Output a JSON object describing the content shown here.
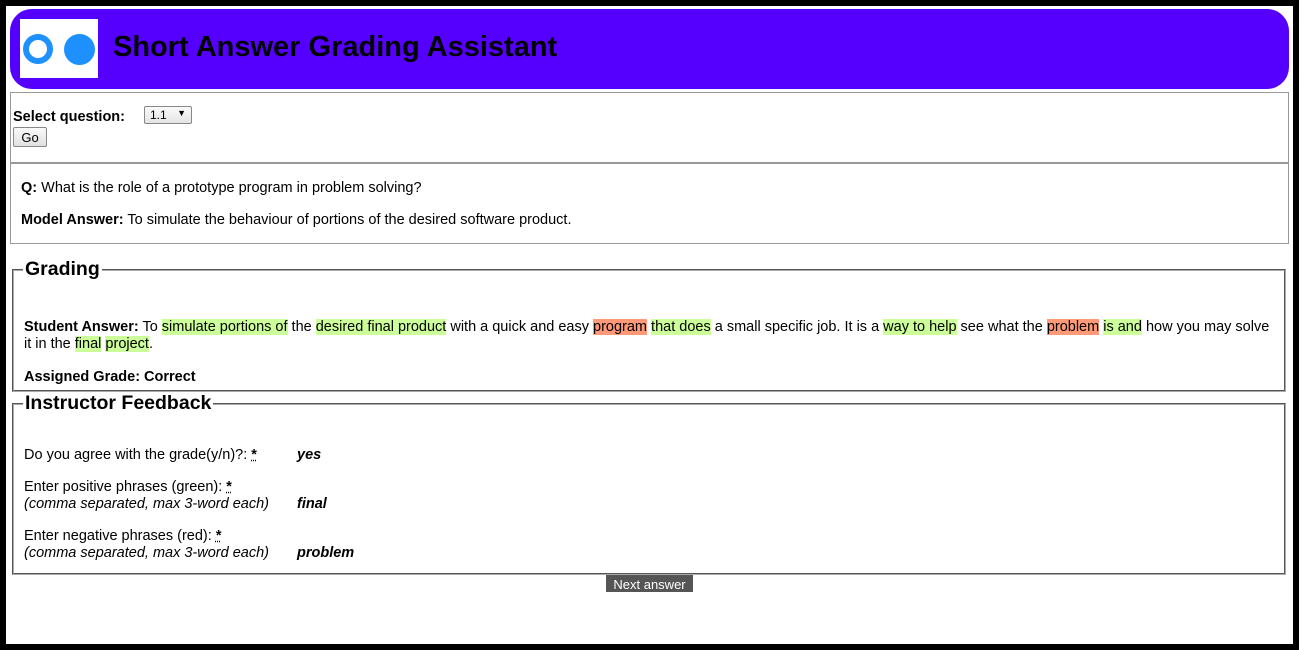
{
  "app": {
    "title": "Short Answer Grading Assistant",
    "header_color": "#5500ff",
    "logo_color": "#1e90ff"
  },
  "select": {
    "label": "Select question:",
    "value": "1.1",
    "go_label": "Go"
  },
  "question": {
    "q_label": "Q:",
    "q_text": "What is the role of a prototype program in problem solving?",
    "model_label": "Model Answer:",
    "model_text": "To simulate the behaviour of portions of the desired software product."
  },
  "grading": {
    "legend": "Grading",
    "student_label": "Student Answer:",
    "segments": [
      {
        "text": " To ",
        "hl": ""
      },
      {
        "text": "simulate portions of",
        "hl": "g"
      },
      {
        "text": " the ",
        "hl": ""
      },
      {
        "text": "desired final product",
        "hl": "g"
      },
      {
        "text": " with a quick and easy ",
        "hl": ""
      },
      {
        "text": "program",
        "hl": "r"
      },
      {
        "text": " ",
        "hl": ""
      },
      {
        "text": "that does",
        "hl": "g"
      },
      {
        "text": " a small specific job. It is a ",
        "hl": ""
      },
      {
        "text": "way to help",
        "hl": "g"
      },
      {
        "text": " see what the ",
        "hl": ""
      },
      {
        "text": "problem",
        "hl": "r"
      },
      {
        "text": " ",
        "hl": ""
      },
      {
        "text": "is and",
        "hl": "g"
      },
      {
        "text": " how you may solve it in the ",
        "hl": ""
      },
      {
        "text": "final",
        "hl": "g"
      },
      {
        "text": " ",
        "hl": ""
      },
      {
        "text": "project",
        "hl": "g"
      },
      {
        "text": ".",
        "hl": ""
      }
    ],
    "grade_label": "Assigned Grade: Correct",
    "positive_color": "#ccff99",
    "negative_color": "#ff9977"
  },
  "feedback": {
    "legend": "Instructor Feedback",
    "agree_label": "Do you agree with the grade(y/n)?: ",
    "agree_value": "yes",
    "positive_label": "Enter positive phrases (green): ",
    "positive_hint": "(comma separated, max 3-word each)",
    "positive_value": "final",
    "negative_label": "Enter negative phrases (red): ",
    "negative_hint": "(comma separated, max 3-word each)",
    "negative_value": "problem",
    "required_marker": "*"
  },
  "next_label": "Next answer"
}
